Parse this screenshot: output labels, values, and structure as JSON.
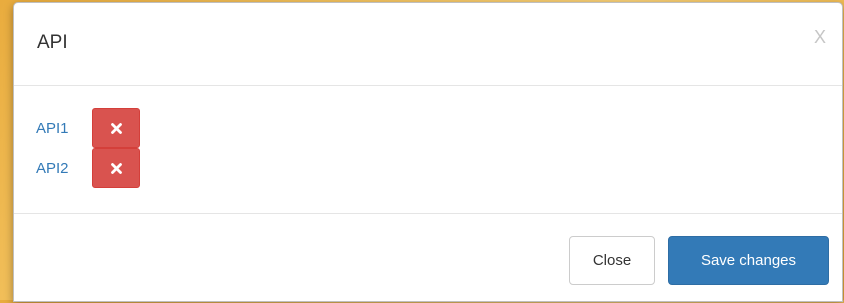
{
  "modal": {
    "title": "API",
    "close_glyph": "X"
  },
  "apis": [
    {
      "label": "API1",
      "remove_icon": "times-icon"
    },
    {
      "label": "API2",
      "remove_icon": "times-icon"
    }
  ],
  "footer": {
    "close_label": "Close",
    "save_label": "Save changes"
  },
  "colors": {
    "primary": "#337ab7",
    "danger": "#d9534f",
    "link": "#337ab7"
  }
}
